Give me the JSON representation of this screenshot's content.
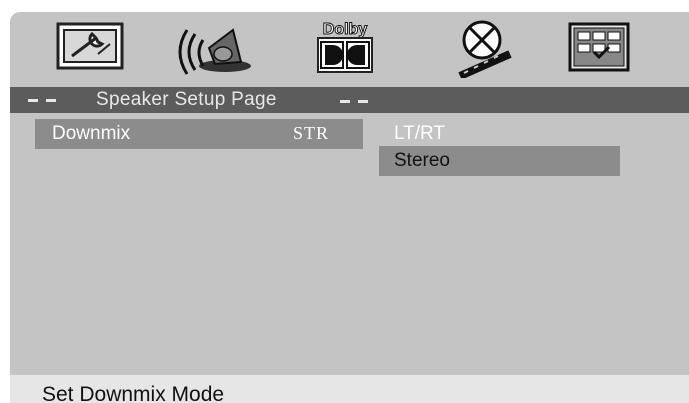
{
  "icons": {
    "general": "general-setup-icon",
    "speaker": "speaker-setup-icon",
    "dolby": "dolby-digital-icon",
    "video": "video-setup-icon",
    "preference": "preference-setup-icon"
  },
  "dolby_label": "Dolby",
  "page_title": "Speaker Setup Page",
  "menu": {
    "items": [
      {
        "label": "Downmix",
        "value": "STR"
      }
    ]
  },
  "options": [
    {
      "label": "LT/RT"
    },
    {
      "label": "Stereo"
    }
  ],
  "status": "Set Downmix Mode",
  "colors": {
    "screen_bg": "#c4c4c4",
    "title_bar": "#5c5c5c",
    "highlight": "#8c8c8c",
    "status_bg": "#e6e6e6"
  }
}
